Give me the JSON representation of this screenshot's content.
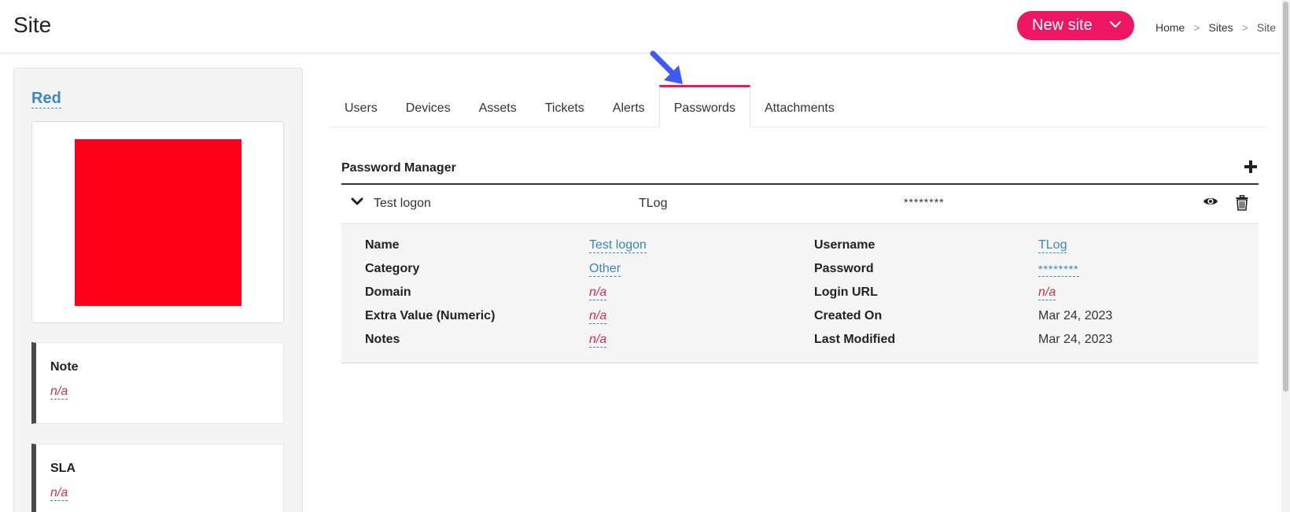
{
  "header": {
    "title": "Site",
    "new_site_label": "New site",
    "breadcrumb": {
      "home": "Home",
      "sites": "Sites",
      "current": "Site",
      "separator": ">"
    }
  },
  "sidebar": {
    "site_name": "Red",
    "logo_color": "#ff0018",
    "cards": [
      {
        "label": "Note",
        "value": "n/a"
      },
      {
        "label": "SLA",
        "value": "n/a"
      }
    ]
  },
  "tabs": [
    {
      "label": "Users"
    },
    {
      "label": "Devices"
    },
    {
      "label": "Assets"
    },
    {
      "label": "Tickets"
    },
    {
      "label": "Alerts"
    },
    {
      "label": "Passwords",
      "active": true
    },
    {
      "label": "Attachments"
    }
  ],
  "password_manager": {
    "title": "Password Manager",
    "entry": {
      "name": "Test logon",
      "username": "TLog",
      "password": "********"
    },
    "details": {
      "name_label": "Name",
      "name_value": "Test logon",
      "category_label": "Category",
      "category_value": "Other",
      "domain_label": "Domain",
      "domain_value": "n/a",
      "extra_label": "Extra Value (Numeric)",
      "extra_value": "n/a",
      "notes_label": "Notes",
      "notes_value": "n/a",
      "username_label": "Username",
      "username_value": "TLog",
      "password_label": "Password",
      "password_value": "********",
      "login_url_label": "Login URL",
      "login_url_value": "n/a",
      "created_label": "Created On",
      "created_value": "Mar 24, 2023",
      "modified_label": "Last Modified",
      "modified_value": "Mar 24, 2023"
    }
  },
  "colors": {
    "accent": "#ed1662",
    "link": "#3a86c8",
    "na": "#d32f4a",
    "arrow": "#3d5afe"
  }
}
